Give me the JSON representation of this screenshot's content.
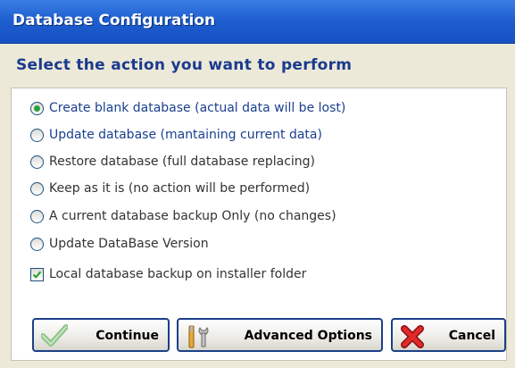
{
  "window": {
    "title": "Database Configuration"
  },
  "heading": "Select the action you want to perform",
  "options": [
    {
      "label": "Create blank database (actual data will be lost)",
      "selected": true
    },
    {
      "label": "Update database  (mantaining current data)",
      "selected": false
    },
    {
      "label": "Restore database (full database replacing)",
      "selected": false
    },
    {
      "label": "Keep as it is (no action will be performed)",
      "selected": false
    },
    {
      "label": "A current database backup Only (no changes)",
      "selected": false
    },
    {
      "label": "Update DataBase Version",
      "selected": false
    }
  ],
  "backup_checkbox": {
    "label": "Local database backup on installer folder",
    "checked": true
  },
  "buttons": {
    "continue": "Continue",
    "advanced": "Advanced Options",
    "cancel": "Cancel"
  },
  "icons": {
    "continue": "checkmark-icon",
    "advanced": "tools-icon",
    "cancel": "red-x-icon"
  }
}
